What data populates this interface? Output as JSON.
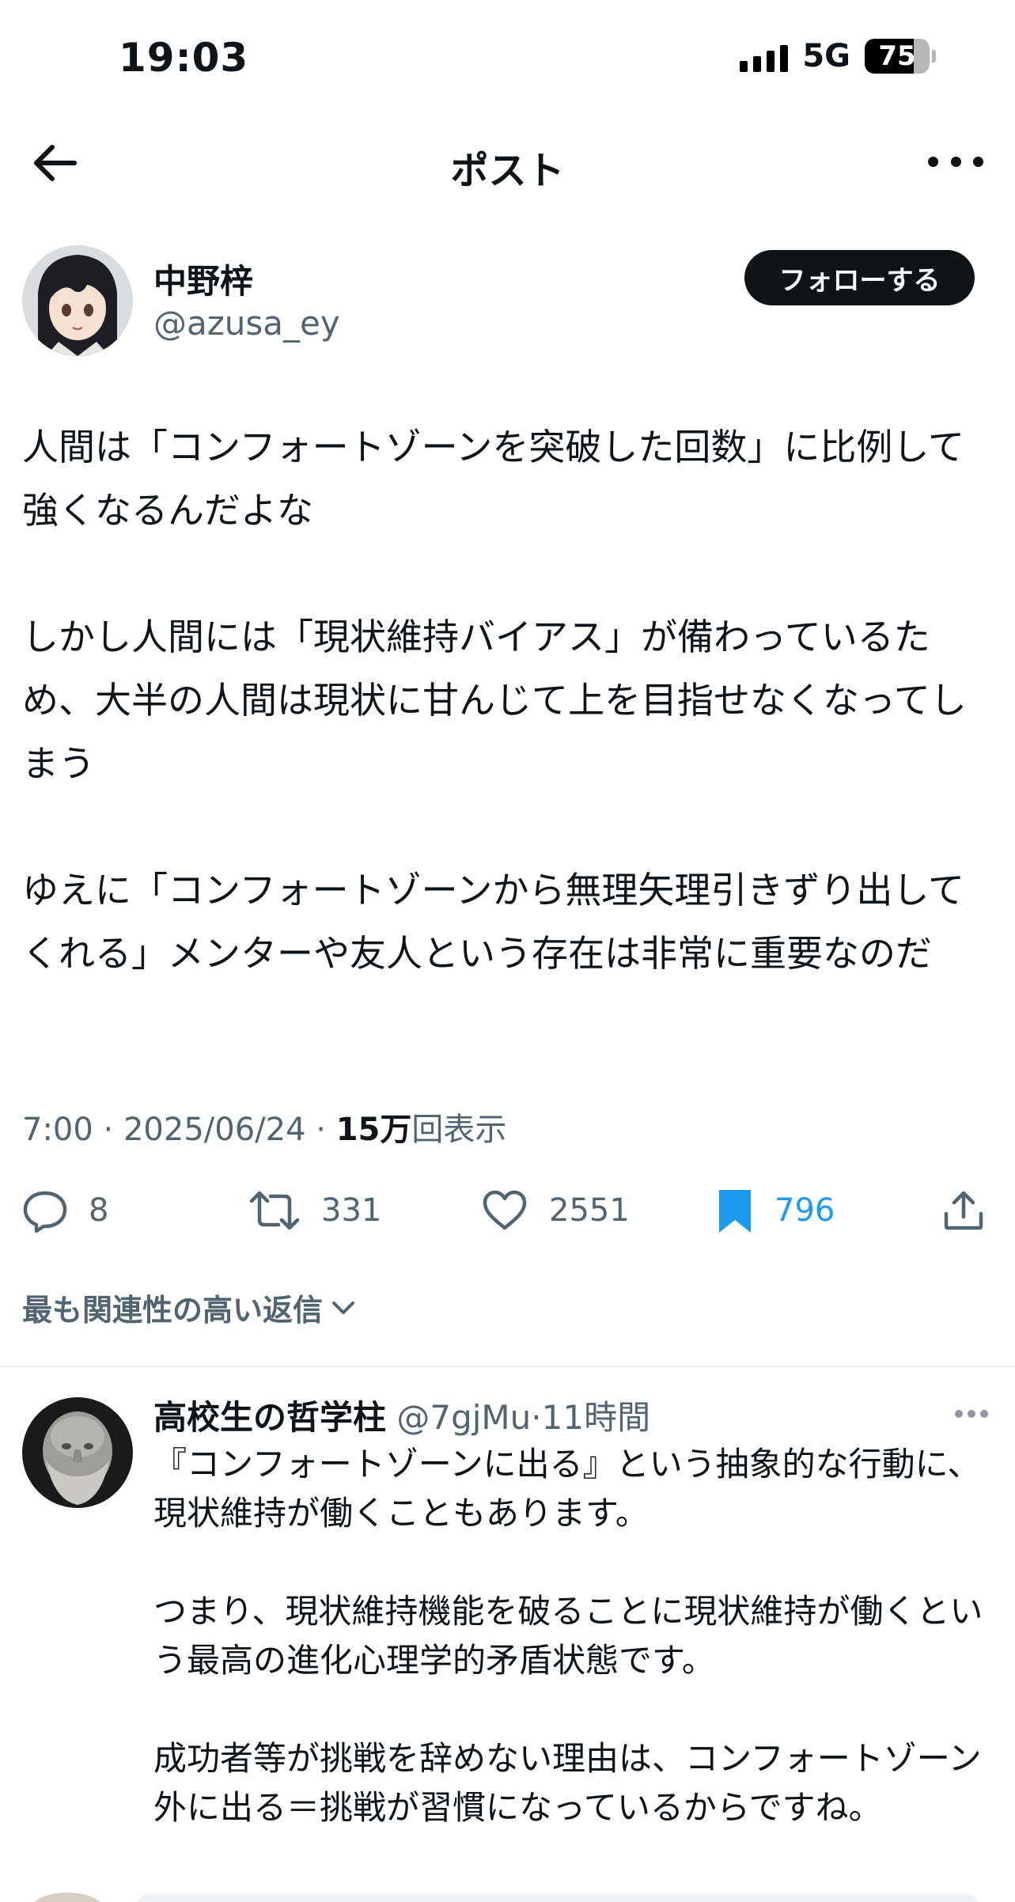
{
  "status_bar": {
    "time": "19:03",
    "network": "5G",
    "battery": "75",
    "battery_level": 0.75
  },
  "header": {
    "title": "ポスト",
    "back_icon": "arrow-left-icon",
    "more_icon": "more-horizontal-icon"
  },
  "post": {
    "author": {
      "name": "中野梓",
      "handle": "@azusa_ey"
    },
    "follow_label": "フォローする",
    "paragraphs": [
      "人間は「コンフォートゾーンを突破した回数」に比例して強くなるんだよな",
      "しかし人間には「現状維持バイアス」が備わっているため、大半の人間は現状に甘んじて上を目指せなくなってしまう",
      "ゆえに「コンフォートゾーンから無理矢理引きずり出してくれる」メンターや友人という存在は非常に重要なのだ"
    ],
    "meta": {
      "time": "7:00",
      "separator": "·",
      "date": "2025/06/24",
      "views_count": "15万",
      "views_label": "回表示"
    },
    "actions": {
      "replies": "8",
      "reposts": "331",
      "likes": "2551",
      "bookmarks": "796"
    }
  },
  "replies_sort_label": "最も関連性の高い返信",
  "reply": {
    "name": "高校生の哲学柱",
    "handle": "@7gjMu",
    "separator": "·",
    "time": "11時間",
    "paragraphs": [
      "『コンフォートゾーンに出る』という抽象的な行動に、現状維持が働くこともあります。",
      "つまり、現状維持機能を破ることに現状維持が働くという最高の進化心理学的矛盾状態です。",
      "成功者等が挑戦を辞めない理由は、コンフォートゾーン外に出る＝挑戦が習慣になっているからですね。"
    ]
  },
  "colors": {
    "text": "#0f1419",
    "secondary": "#536471",
    "accent": "#1d9bf0"
  }
}
